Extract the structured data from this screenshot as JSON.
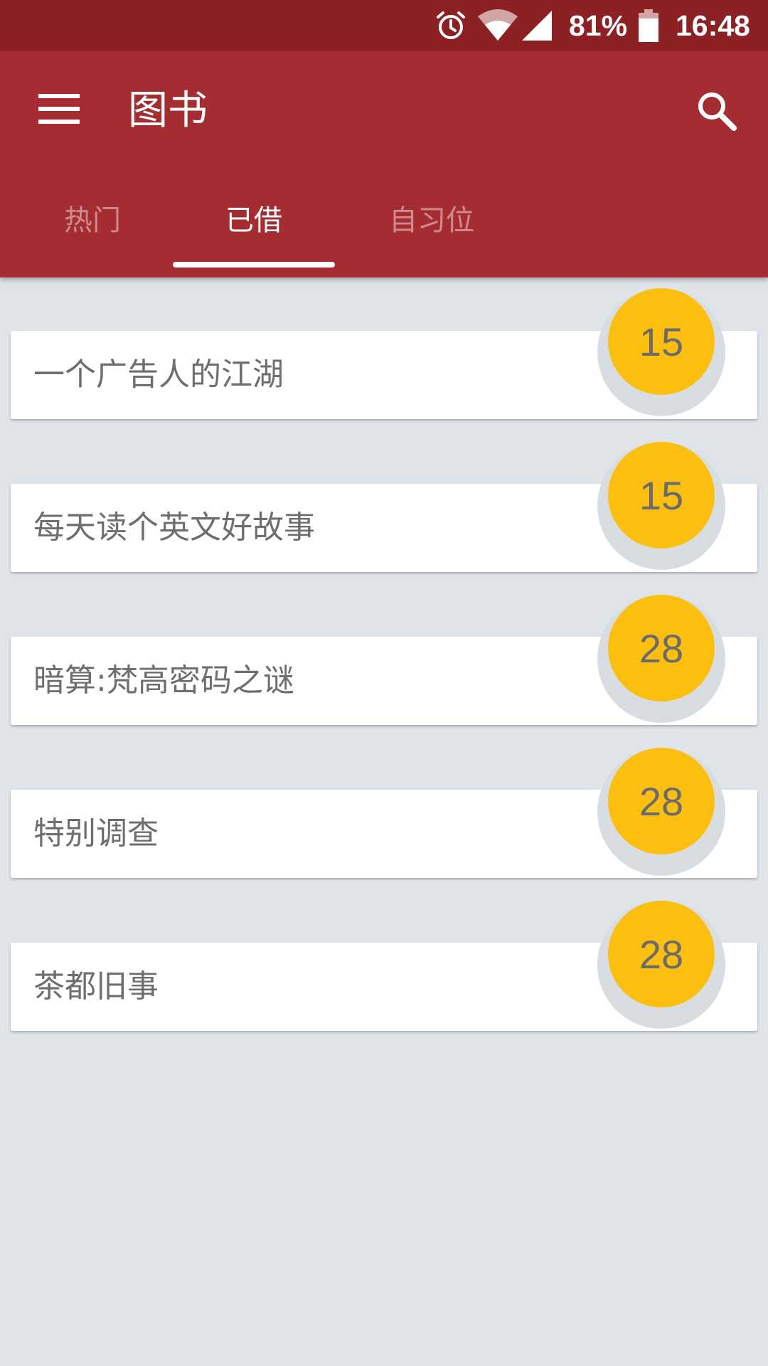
{
  "status_bar": {
    "battery": "81%",
    "time": "16:48",
    "icons": [
      "alarm-icon",
      "wifi-icon",
      "cell-signal-icon",
      "battery-icon"
    ]
  },
  "app_bar": {
    "title": "图书",
    "menu_icon": "menu-icon",
    "search_icon": "search-icon",
    "color": "#a52d31"
  },
  "tabs": [
    {
      "label": "热门",
      "selected": false
    },
    {
      "label": "已借",
      "selected": true
    },
    {
      "label": "自习位",
      "selected": false
    }
  ],
  "books": [
    {
      "title": "一个广告人的江湖",
      "count": "15"
    },
    {
      "title": "每天读个英文好故事",
      "count": "15"
    },
    {
      "title": "暗算:梵高密码之谜",
      "count": "28"
    },
    {
      "title": "特别调查",
      "count": "28"
    },
    {
      "title": "茶都旧事",
      "count": "28"
    }
  ],
  "colors": {
    "status_bar": "#8c2022",
    "badge": "#fdbf0f",
    "background": "#dfe4e9"
  }
}
